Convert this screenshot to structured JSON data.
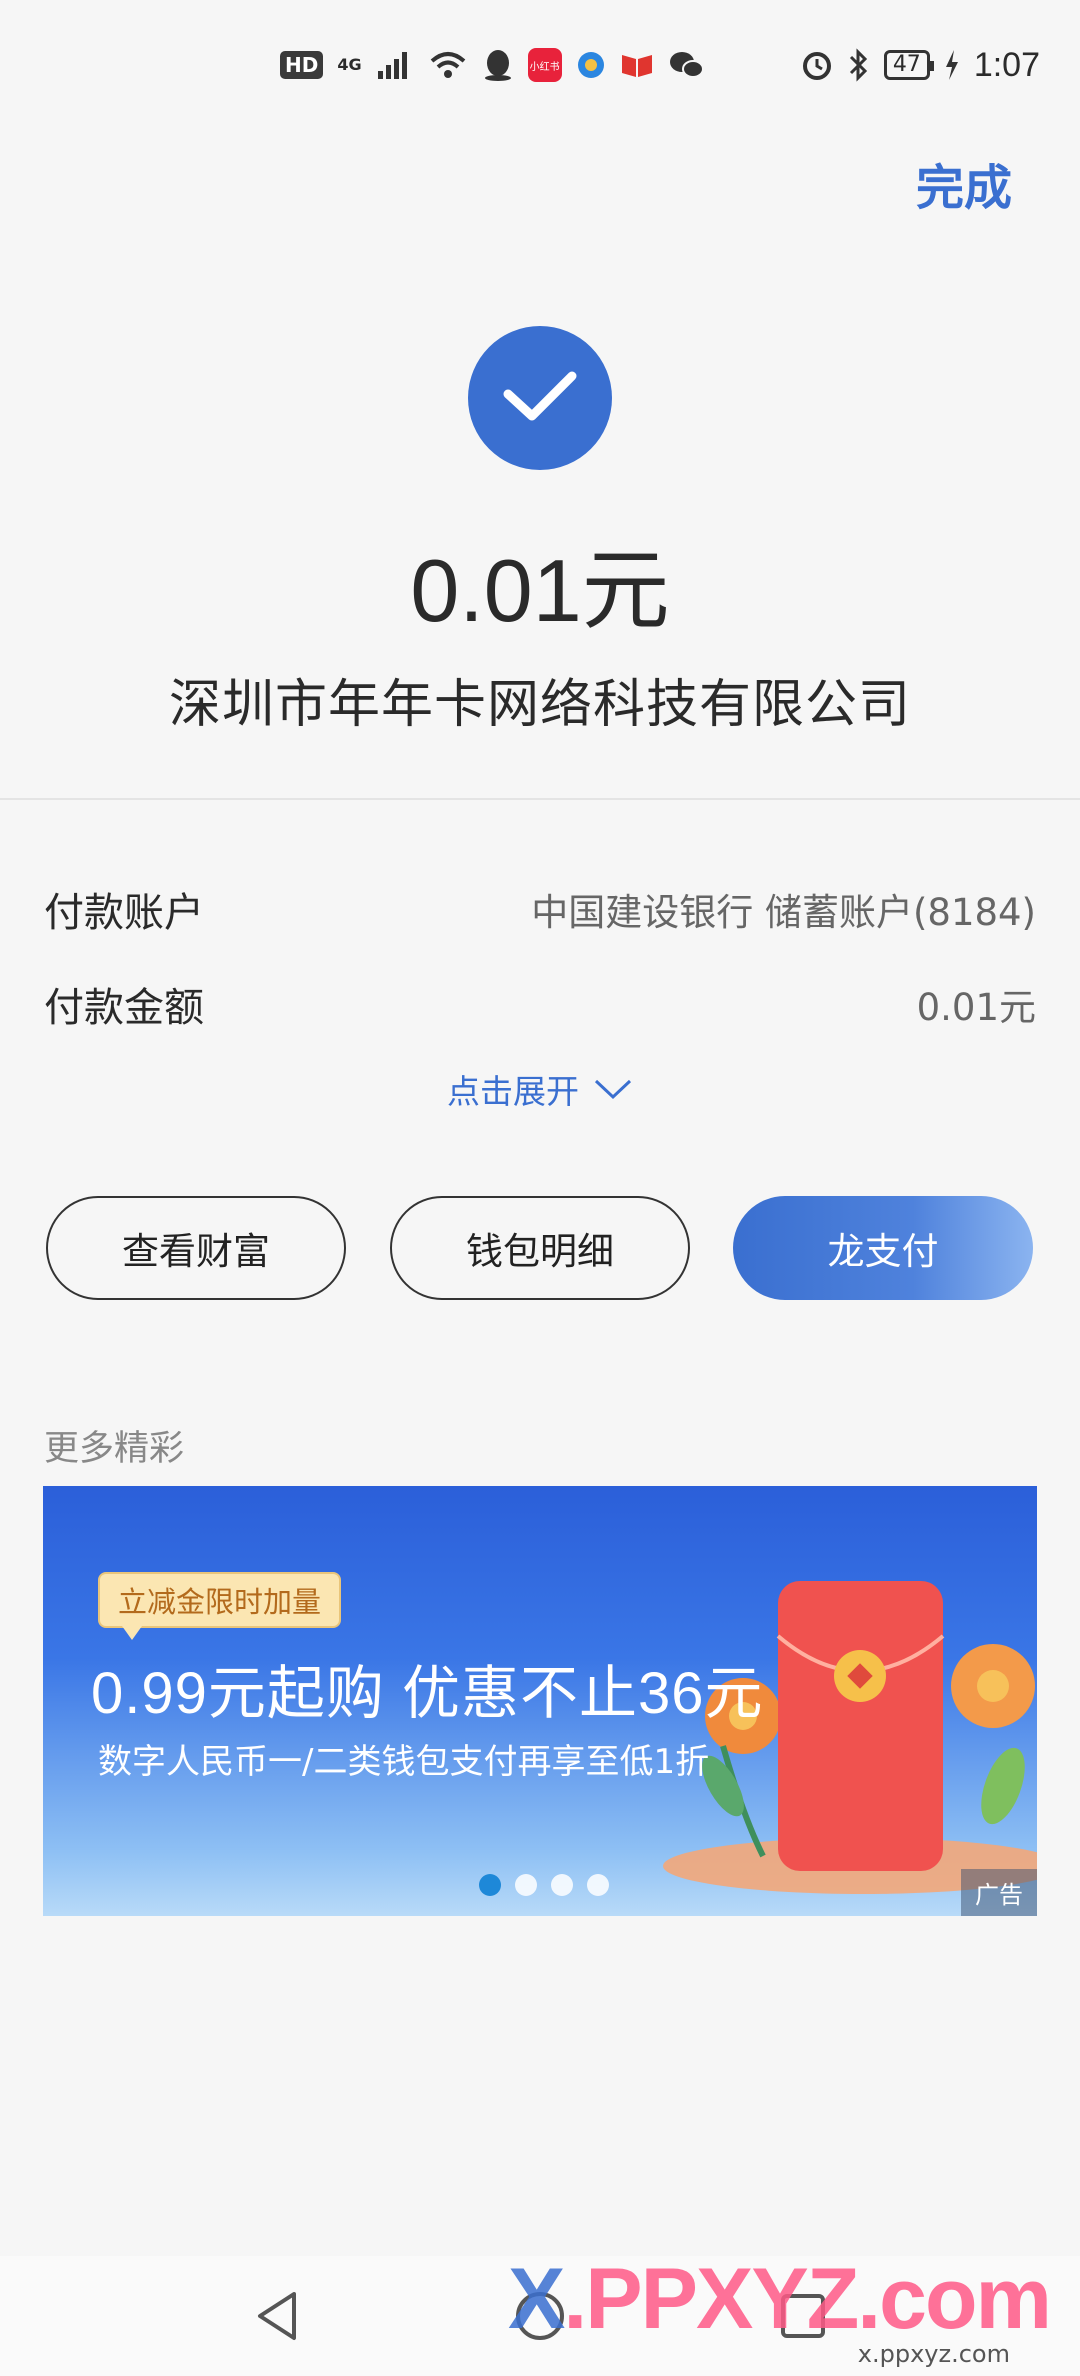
{
  "status_bar": {
    "hd": "HD",
    "network": "4G",
    "battery": "47",
    "time": "1:07",
    "app_icon_label": "小红书"
  },
  "header": {
    "done_label": "完成"
  },
  "result": {
    "amount": "0.01元",
    "merchant": "深圳市年年卡网络科技有限公司"
  },
  "details": [
    {
      "label": "付款账户",
      "value": "中国建设银行 储蓄账户(8184)"
    },
    {
      "label": "付款金额",
      "value": "0.01元"
    }
  ],
  "expand_label": "点击展开",
  "actions": {
    "wealth": "查看财富",
    "wallet": "钱包明细",
    "pay": "龙支付"
  },
  "more": {
    "title": "更多精彩",
    "banner": {
      "tag": "立减金限时加量",
      "headline": "0.99元起购 优惠不止36元",
      "subline": "数字人民币一/二类钱包支付再享至低1折",
      "ad_label": "广告",
      "slide_count": 4,
      "active_slide": 1
    }
  },
  "watermark": {
    "brand_main": "X",
    "brand_rest": ".PPXYZ.com",
    "url": "x.ppxyz.com"
  },
  "colors": {
    "accent": "#3a6fd0",
    "background": "#f6f6f6"
  }
}
